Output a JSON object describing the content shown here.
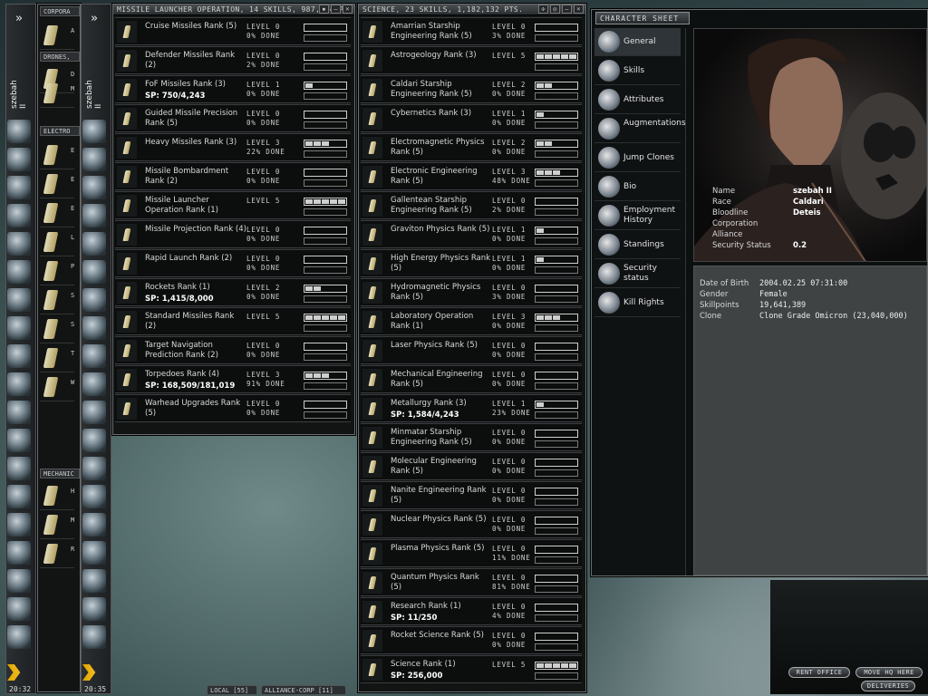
{
  "window_title": "Character Sheet",
  "sidebars": [
    {
      "name": "szebah II",
      "time": "20:32"
    },
    {
      "name": "szebah II",
      "time": "20:35"
    }
  ],
  "back_panel": {
    "headers": [
      "CORPORA",
      "DRONES,",
      "ELECTRO",
      "MECHANIC"
    ],
    "rows": [
      {
        "t": "A"
      },
      {
        "t": "D"
      },
      {
        "t": "M"
      },
      {
        "t": "E"
      },
      {
        "t": "E"
      },
      {
        "t": "E"
      },
      {
        "t": "L"
      },
      {
        "t": "P"
      },
      {
        "t": "S"
      },
      {
        "t": "S"
      },
      {
        "t": "T"
      },
      {
        "t": "W"
      },
      {
        "t": "H"
      },
      {
        "t": "M"
      },
      {
        "t": "R"
      }
    ]
  },
  "missile": {
    "title": "MISSILE LAUNCHER OPERATION, 14 SKILLS, 987,494 PTS.",
    "skills": [
      {
        "name": "Cruise Missiles Rank (5)",
        "sp": "",
        "level": "LEVEL 0",
        "done": "0% DONE",
        "lvl": 0
      },
      {
        "name": "Defender Missiles Rank (2)",
        "sp": "",
        "level": "LEVEL 0",
        "done": "2% DONE",
        "lvl": 0
      },
      {
        "name": "FoF Missiles Rank (3)",
        "sp": "SP: 750/4,243",
        "level": "LEVEL 1",
        "done": "0% DONE",
        "lvl": 1
      },
      {
        "name": "Guided Missile Precision Rank (5)",
        "sp": "",
        "level": "LEVEL 0",
        "done": "0% DONE",
        "lvl": 0
      },
      {
        "name": "Heavy Missiles Rank (3)",
        "sp": "",
        "level": "LEVEL 3",
        "done": "22% DONE",
        "lvl": 3
      },
      {
        "name": "Missile Bombardment Rank (2)",
        "sp": "",
        "level": "LEVEL 0",
        "done": "0% DONE",
        "lvl": 0
      },
      {
        "name": "Missile Launcher Operation Rank (1)",
        "sp": "",
        "level": "LEVEL 5",
        "done": "",
        "lvl": 5
      },
      {
        "name": "Missile Projection Rank (4)",
        "sp": "",
        "level": "LEVEL 0",
        "done": "0% DONE",
        "lvl": 0
      },
      {
        "name": "Rapid Launch Rank (2)",
        "sp": "",
        "level": "LEVEL 0",
        "done": "0% DONE",
        "lvl": 0
      },
      {
        "name": "Rockets Rank (1)",
        "sp": "SP: 1,415/8,000",
        "level": "LEVEL 2",
        "done": "0% DONE",
        "lvl": 2
      },
      {
        "name": "Standard Missiles Rank (2)",
        "sp": "",
        "level": "LEVEL 5",
        "done": "",
        "lvl": 5
      },
      {
        "name": "Target Navigation Prediction Rank (2)",
        "sp": "",
        "level": "LEVEL 0",
        "done": "0% DONE",
        "lvl": 0
      },
      {
        "name": "Torpedoes Rank (4)",
        "sp": "SP: 168,509/181,019",
        "level": "LEVEL 3",
        "done": "91% DONE",
        "lvl": 3
      },
      {
        "name": "Warhead Upgrades Rank (5)",
        "sp": "",
        "level": "LEVEL 0",
        "done": "0% DONE",
        "lvl": 0
      }
    ]
  },
  "science": {
    "title": "SCIENCE, 23 SKILLS, 1,182,132 PTS.",
    "skills": [
      {
        "name": "Amarrian Starship Engineering Rank (5)",
        "sp": "",
        "level": "LEVEL 0",
        "done": "3% DONE",
        "lvl": 0
      },
      {
        "name": "Astrogeology Rank (3)",
        "sp": "",
        "level": "LEVEL 5",
        "done": "",
        "lvl": 5
      },
      {
        "name": "Caldari Starship Engineering Rank (5)",
        "sp": "",
        "level": "LEVEL 2",
        "done": "0% DONE",
        "lvl": 2
      },
      {
        "name": "Cybernetics Rank (3)",
        "sp": "",
        "level": "LEVEL 1",
        "done": "0% DONE",
        "lvl": 1
      },
      {
        "name": "Electromagnetic Physics Rank (5)",
        "sp": "",
        "level": "LEVEL 2",
        "done": "0% DONE",
        "lvl": 2
      },
      {
        "name": "Electronic Engineering Rank (5)",
        "sp": "",
        "level": "LEVEL 3",
        "done": "48% DONE",
        "lvl": 3
      },
      {
        "name": "Gallentean Starship Engineering Rank (5)",
        "sp": "",
        "level": "LEVEL 0",
        "done": "2% DONE",
        "lvl": 0
      },
      {
        "name": "Graviton Physics Rank (5)",
        "sp": "",
        "level": "LEVEL 1",
        "done": "0% DONE",
        "lvl": 1
      },
      {
        "name": "High Energy Physics Rank (5)",
        "sp": "",
        "level": "LEVEL 1",
        "done": "0% DONE",
        "lvl": 1
      },
      {
        "name": "Hydromagnetic Physics Rank (5)",
        "sp": "",
        "level": "LEVEL 0",
        "done": "3% DONE",
        "lvl": 0
      },
      {
        "name": "Laboratory Operation Rank (1)",
        "sp": "",
        "level": "LEVEL 3",
        "done": "0% DONE",
        "lvl": 3
      },
      {
        "name": "Laser Physics Rank (5)",
        "sp": "",
        "level": "LEVEL 0",
        "done": "0% DONE",
        "lvl": 0
      },
      {
        "name": "Mechanical Engineering Rank (5)",
        "sp": "",
        "level": "LEVEL 0",
        "done": "0% DONE",
        "lvl": 0
      },
      {
        "name": "Metallurgy Rank (3)",
        "sp": "SP: 1,584/4,243",
        "level": "LEVEL 1",
        "done": "23% DONE",
        "lvl": 1
      },
      {
        "name": "Minmatar Starship Engineering Rank (5)",
        "sp": "",
        "level": "LEVEL 0",
        "done": "0% DONE",
        "lvl": 0
      },
      {
        "name": "Molecular Engineering Rank (5)",
        "sp": "",
        "level": "LEVEL 0",
        "done": "0% DONE",
        "lvl": 0
      },
      {
        "name": "Nanite Engineering Rank (5)",
        "sp": "",
        "level": "LEVEL 0",
        "done": "0% DONE",
        "lvl": 0
      },
      {
        "name": "Nuclear Physics Rank (5)",
        "sp": "",
        "level": "LEVEL 0",
        "done": "0% DONE",
        "lvl": 0
      },
      {
        "name": "Plasma Physics Rank (5)",
        "sp": "",
        "level": "LEVEL 0",
        "done": "11% DONE",
        "lvl": 0
      },
      {
        "name": "Quantum Physics Rank (5)",
        "sp": "",
        "level": "LEVEL 0",
        "done": "81% DONE",
        "lvl": 0
      },
      {
        "name": "Research Rank (1)",
        "sp": "SP: 11/250",
        "level": "LEVEL 0",
        "done": "4% DONE",
        "lvl": 0
      },
      {
        "name": "Rocket Science Rank (5)",
        "sp": "",
        "level": "LEVEL 0",
        "done": "0% DONE",
        "lvl": 0
      },
      {
        "name": "Science Rank (1)",
        "sp": "SP: 256,000",
        "level": "LEVEL 5",
        "done": "",
        "lvl": 5
      }
    ]
  },
  "character": {
    "tab": "CHARACTER SHEET",
    "nav": [
      {
        "label": "General",
        "icon": "general-icon"
      },
      {
        "label": "Skills",
        "icon": "skills-icon"
      },
      {
        "label": "Attributes",
        "icon": "attributes-icon"
      },
      {
        "label": "Augmentations",
        "icon": "augmentations-icon"
      },
      {
        "label": "Jump Clones",
        "icon": "jump-clones-icon"
      },
      {
        "label": "Bio",
        "icon": "bio-icon"
      },
      {
        "label": "Employment History",
        "icon": "employment-icon"
      },
      {
        "label": "Standings",
        "icon": "standings-icon"
      },
      {
        "label": "Security status",
        "icon": "security-icon"
      },
      {
        "label": "Kill Rights",
        "icon": "kill-rights-icon"
      }
    ],
    "info": [
      {
        "k": "Name",
        "v": "szebah II"
      },
      {
        "k": "Race",
        "v": "Caldari"
      },
      {
        "k": "Bloodline",
        "v": "Deteis"
      },
      {
        "k": "Corporation",
        "v": ""
      },
      {
        "k": "Alliance",
        "v": ""
      },
      {
        "k": "Security Status",
        "v": "0.2"
      }
    ],
    "details": [
      {
        "k": "Date of Birth",
        "v": "2004.02.25 07:31:00"
      },
      {
        "k": "Gender",
        "v": "Female"
      },
      {
        "k": "Skillpoints",
        "v": "19,641,389"
      },
      {
        "k": "Clone",
        "v": "Clone Grade Omicron (23,040,000)"
      }
    ]
  },
  "station_buttons": [
    "RENT OFFICE",
    "MOVE HQ HERE",
    "DELIVERIES"
  ],
  "chat_tabs": [
    "LOCAL [55]",
    "ALLIANCE-CORP [11]"
  ]
}
